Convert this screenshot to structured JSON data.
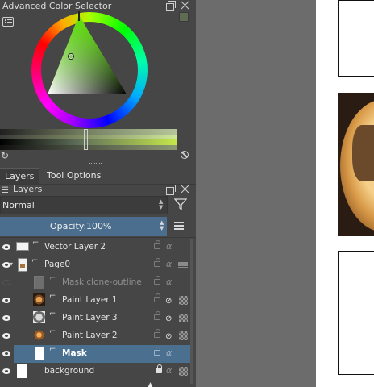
{
  "color_selector": {
    "title": "Advanced Color Selector",
    "current_color": "#5f6b54"
  },
  "tabs": [
    {
      "label": "Layers"
    },
    {
      "label": "Tool Options"
    }
  ],
  "layers_panel": {
    "title": "Layers",
    "blend_mode": "Normal",
    "opacity_label": "Opacity:",
    "opacity_value": "100%",
    "layers": [
      {
        "name": "Vector Layer 2",
        "visible": true,
        "selected": false,
        "icon": "vector-layer-icon"
      },
      {
        "name": "Page0",
        "visible": true,
        "selected": false,
        "icon": "group-layer-icon"
      },
      {
        "name": "Mask clone-outline",
        "visible": false,
        "selected": false,
        "icon": "clone-layer-icon"
      },
      {
        "name": "Paint Layer 1",
        "visible": true,
        "selected": false,
        "icon": "paint-layer-icon"
      },
      {
        "name": "Paint Layer 3",
        "visible": true,
        "selected": false,
        "icon": "paint-layer-icon"
      },
      {
        "name": "Paint Layer 2",
        "visible": true,
        "selected": false,
        "icon": "paint-layer-icon"
      },
      {
        "name": "Mask",
        "visible": true,
        "selected": true,
        "icon": "paint-layer-icon"
      },
      {
        "name": "background",
        "visible": true,
        "selected": false,
        "icon": "locked-icon"
      }
    ]
  },
  "colors": {
    "dock_bg": "#464646",
    "selection": "#4a6f8f",
    "opacity_bar": "#4b6e8e",
    "canvas_gray": "#6c6c6c"
  }
}
